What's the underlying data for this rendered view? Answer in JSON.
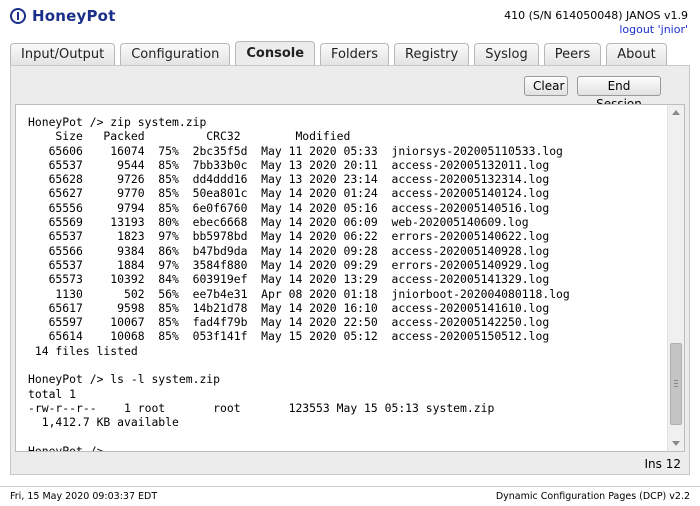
{
  "app": {
    "title": "HoneyPot",
    "device_info": "410 (S/N 614050048) JANOS v1.9",
    "logout_label": "logout 'jnior'"
  },
  "tabs": [
    {
      "label": "Input/Output"
    },
    {
      "label": "Configuration"
    },
    {
      "label": "Console",
      "active": true
    },
    {
      "label": "Folders"
    },
    {
      "label": "Registry"
    },
    {
      "label": "Syslog"
    },
    {
      "label": "Peers"
    },
    {
      "label": "About"
    }
  ],
  "console": {
    "clear_label": "Clear",
    "end_session_label": "End Session",
    "output": "HoneyPot /> zip system.zip\n    Size   Packed         CRC32        Modified\n   65606    16074  75%  2bc35f5d  May 11 2020 05:33  jniorsys-202005110533.log\n   65537     9544  85%  7bb33b0c  May 13 2020 20:11  access-202005132011.log\n   65628     9726  85%  dd4ddd16  May 13 2020 23:14  access-202005132314.log\n   65627     9770  85%  50ea801c  May 14 2020 01:24  access-202005140124.log\n   65556     9794  85%  6e0f6760  May 14 2020 05:16  access-202005140516.log\n   65569    13193  80%  ebec6668  May 14 2020 06:09  web-202005140609.log\n   65537     1823  97%  bb5978bd  May 14 2020 06:22  errors-202005140622.log\n   65566     9384  86%  b47bd9da  May 14 2020 09:28  access-202005140928.log\n   65537     1884  97%  3584f880  May 14 2020 09:29  errors-202005140929.log\n   65573    10392  84%  603919ef  May 14 2020 13:29  access-202005141329.log\n    1130      502  56%  ee7b4e31  Apr 08 2020 01:18  jniorboot-202004080118.log\n   65617     9598  85%  14b21d78  May 14 2020 16:10  access-202005141610.log\n   65597    10067  85%  fad4f79b  May 14 2020 22:50  access-202005142250.log\n   65614    10068  85%  053f141f  May 15 2020 05:12  access-202005150512.log\n 14 files listed\n\nHoneyPot /> ls -l system.zip\ntotal 1\n-rw-r--r--    1 root       root       123553 May 15 05:13 system.zip\n  1,412.7 KB available\n\nHoneyPot />",
    "status": "Ins 12"
  },
  "footer": {
    "datetime": "Fri, 15 May 2020 09:03:37 EDT",
    "product": "Dynamic Configuration Pages (DCP) v2.2"
  },
  "colors": {
    "brand": "#1a2f8a",
    "link": "#1a2fd0",
    "panel_bg": "#ececec"
  }
}
